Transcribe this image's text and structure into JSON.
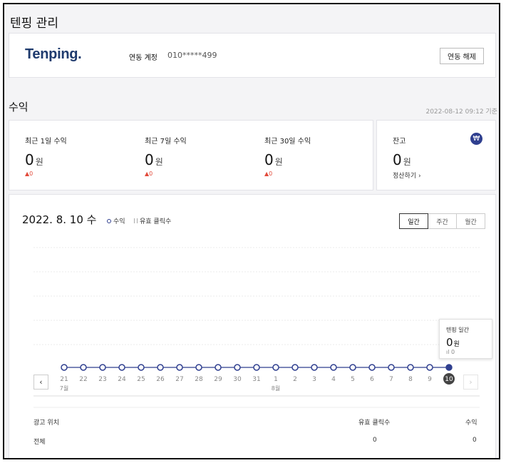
{
  "page": {
    "title": "텐핑 관리"
  },
  "account": {
    "logo": "Tenping.",
    "label": "연동 계정",
    "value": "010*****499",
    "unlink_label": "연동 해제"
  },
  "revenue": {
    "section_title": "수익",
    "as_of": "2022-08-12 09:12 기준",
    "stats": [
      {
        "label": "최근 1일 수익",
        "value": "0",
        "unit": "원",
        "delta": "▲0"
      },
      {
        "label": "최근 7일 수익",
        "value": "0",
        "unit": "원",
        "delta": "▲0"
      },
      {
        "label": "최근 30일 수익",
        "value": "0",
        "unit": "원",
        "delta": "▲0"
      }
    ],
    "balance": {
      "label": "잔고",
      "value": "0",
      "unit": "원",
      "icon": "won-icon",
      "icon_glyph": "₩",
      "settle_label": "정산하기 ›"
    }
  },
  "chart_panel": {
    "date": "2022. 8. 10 수",
    "legend": {
      "revenue": "수익",
      "clicks": "유효 클릭수"
    },
    "tabs": [
      "일간",
      "주간",
      "월간"
    ],
    "active_tab": 0,
    "tooltip": {
      "title": "텐핑 일간",
      "value": "0",
      "unit": "원",
      "clicks": "0"
    },
    "prev_icon": "‹",
    "next_icon": "›",
    "accent": "#2f3f8f"
  },
  "chart_data": {
    "type": "line",
    "x": [
      "21",
      "22",
      "23",
      "24",
      "25",
      "26",
      "27",
      "28",
      "29",
      "30",
      "31",
      "1",
      "2",
      "3",
      "4",
      "5",
      "6",
      "7",
      "8",
      "9",
      "10"
    ],
    "month_labels": [
      {
        "at": "21",
        "label": "7월"
      },
      {
        "at": "1",
        "label": "8월"
      }
    ],
    "series": [
      {
        "name": "수익",
        "values": [
          0,
          0,
          0,
          0,
          0,
          0,
          0,
          0,
          0,
          0,
          0,
          0,
          0,
          0,
          0,
          0,
          0,
          0,
          0,
          0,
          0
        ]
      }
    ],
    "selected": "10",
    "grid": true
  },
  "table": {
    "headers": [
      "광고 위치",
      "유효 클릭수",
      "수익"
    ],
    "rows": [
      [
        "전체",
        "0",
        "0"
      ]
    ]
  }
}
